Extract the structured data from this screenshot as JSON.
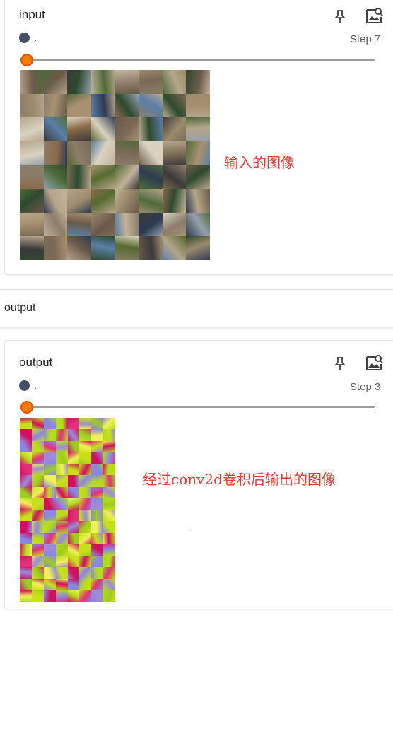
{
  "cards": [
    {
      "title": "input",
      "run_name": ".",
      "step": "Step 7",
      "slider_value": 0,
      "pin_icon": "pin-icon",
      "image_icon": "image-search-icon",
      "grid_cols": 8,
      "grid_rows": 8
    },
    {
      "title": "output",
      "run_name": ".",
      "step": "Step 3",
      "slider_value": 0,
      "pin_icon": "pin-icon",
      "image_icon": "image-search-icon",
      "grid_cols": 8,
      "grid_rows": 16
    }
  ],
  "section": {
    "title": "output"
  },
  "annotations": {
    "input_note": "输入的图像",
    "output_note": "经过conv2d卷积后输出的图像"
  },
  "colors": {
    "run_dot": "#425066",
    "slider_thumb": "#f57c00",
    "note_text": "#e53935",
    "input_palette": [
      "#7a6a55",
      "#4f6b3a",
      "#8b7d6b",
      "#5a7fa8",
      "#3a3a3a",
      "#a89070",
      "#2e4a2e",
      "#b5a58a",
      "#6b5a4a",
      "#94a0ac",
      "#c2b29a",
      "#556b2f",
      "#8c6a4a",
      "#d9d2c0",
      "#2f3b52",
      "#9c8a6c"
    ],
    "output_palette": [
      "#c8e017",
      "#d0115f",
      "#8a86e6",
      "#b5dc1c",
      "#e2307a",
      "#9b8bd8",
      "#9ccc20",
      "#f0f05a"
    ]
  }
}
